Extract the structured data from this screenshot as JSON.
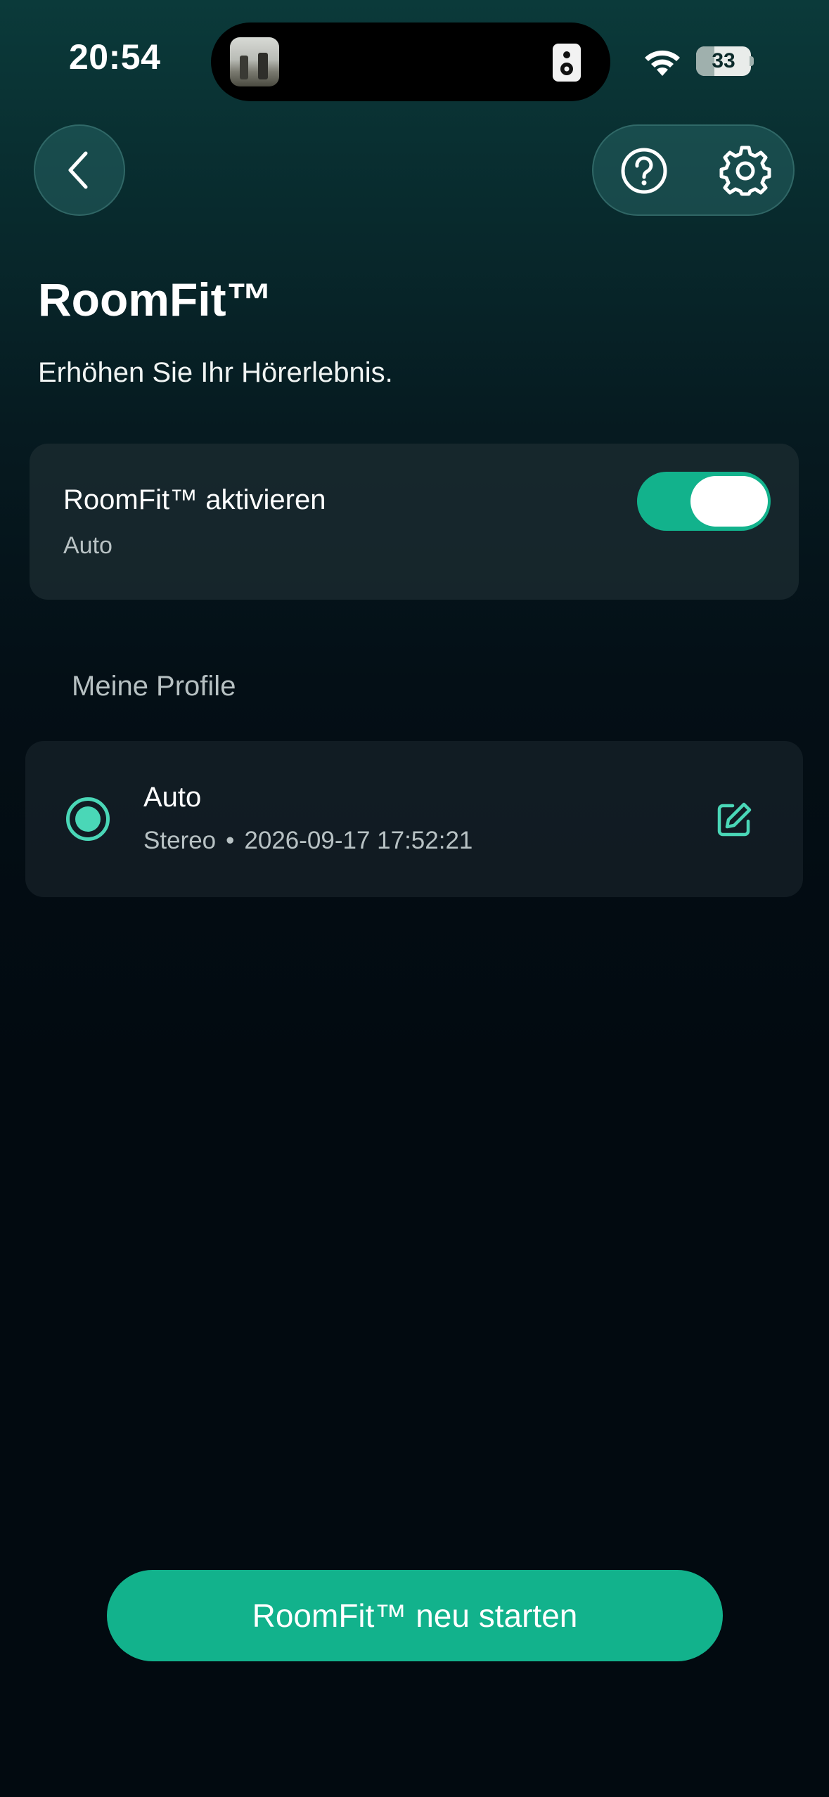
{
  "status_bar": {
    "time": "20:54",
    "battery": "33",
    "battery_level": 0.33
  },
  "nav": {
    "back_icon": "chevron-left-icon",
    "help_icon": "question-circle-icon",
    "settings_icon": "gear-icon"
  },
  "header": {
    "title": "RoomFit™",
    "subtitle": "Erhöhen Sie Ihr Hörerlebnis."
  },
  "toggle_card": {
    "label": "RoomFit™ aktivieren",
    "sub": "Auto",
    "enabled": true
  },
  "profiles": {
    "section_label": "Meine Profile",
    "items": [
      {
        "name": "Auto",
        "type": "Stereo",
        "separator": "•",
        "timestamp": "2026-09-17 17:52:21",
        "selected": true
      }
    ]
  },
  "footer": {
    "restart_label": "RoomFit™ neu starten"
  },
  "colors": {
    "accent": "#12b28c",
    "radio": "#4ad7b7"
  }
}
